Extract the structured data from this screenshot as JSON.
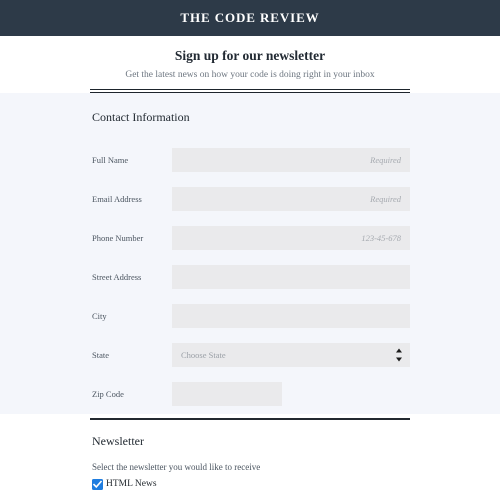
{
  "site": {
    "title": "THE CODE REVIEW",
    "header_bg": "#2d3a48"
  },
  "intro": {
    "title": "Sign up for our newsletter",
    "subtitle": "Get the latest news on how your code is doing right in your inbox"
  },
  "contact": {
    "heading": "Contact Information",
    "fields": [
      {
        "label": "Full Name",
        "value": "",
        "placeholder": "Required",
        "type": "text",
        "align": "right",
        "width": "full"
      },
      {
        "label": "Email Address",
        "value": "",
        "placeholder": "Required",
        "type": "text",
        "align": "right",
        "width": "full"
      },
      {
        "label": "Phone Number",
        "value": "",
        "placeholder": "123-45-678",
        "type": "text",
        "align": "right",
        "width": "full"
      },
      {
        "label": "Street Address",
        "value": "",
        "placeholder": "",
        "type": "text",
        "align": "left",
        "width": "full"
      },
      {
        "label": "City",
        "value": "",
        "placeholder": "",
        "type": "text",
        "align": "left",
        "width": "full"
      },
      {
        "label": "State",
        "value": "Choose State",
        "placeholder": "",
        "type": "select",
        "align": "left",
        "width": "full"
      },
      {
        "label": "Zip Code",
        "value": "",
        "placeholder": "",
        "type": "text",
        "align": "left",
        "width": "narrow"
      }
    ]
  },
  "newsletter": {
    "heading": "Newsletter",
    "subtitle": "Select the newsletter you would like to receive",
    "option_label": "HTML News",
    "option_checked": true,
    "accent": "#1f7de0"
  }
}
